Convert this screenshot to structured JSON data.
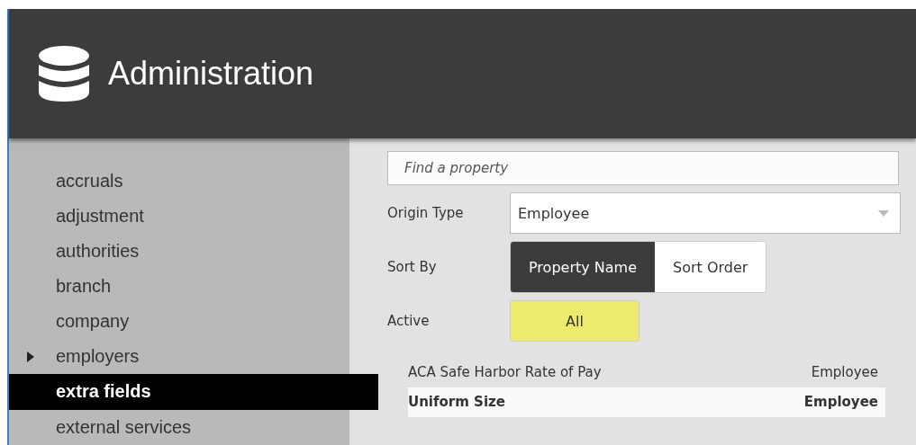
{
  "header": {
    "title": "Administration"
  },
  "sidebar": {
    "items": [
      {
        "label": "accruals",
        "selected": false,
        "has_children": false
      },
      {
        "label": "adjustment",
        "selected": false,
        "has_children": false
      },
      {
        "label": "authorities",
        "selected": false,
        "has_children": false
      },
      {
        "label": "branch",
        "selected": false,
        "has_children": false
      },
      {
        "label": "company",
        "selected": false,
        "has_children": false
      },
      {
        "label": "employers",
        "selected": false,
        "has_children": true
      },
      {
        "label": "extra fields",
        "selected": true,
        "has_children": false
      },
      {
        "label": "external services",
        "selected": false,
        "has_children": false
      }
    ]
  },
  "search": {
    "placeholder": "Find a property"
  },
  "origin_type": {
    "label": "Origin Type",
    "value": "Employee"
  },
  "sort_by": {
    "label": "Sort By",
    "options": [
      {
        "label": "Property Name",
        "selected": true
      },
      {
        "label": "Sort Order",
        "selected": false
      }
    ]
  },
  "active": {
    "label": "Active",
    "value": "All"
  },
  "rows": [
    {
      "name": "ACA Safe Harbor Rate of Pay",
      "origin": "Employee",
      "selected": false
    },
    {
      "name": "Uniform Size",
      "origin": "Employee",
      "selected": true
    }
  ]
}
